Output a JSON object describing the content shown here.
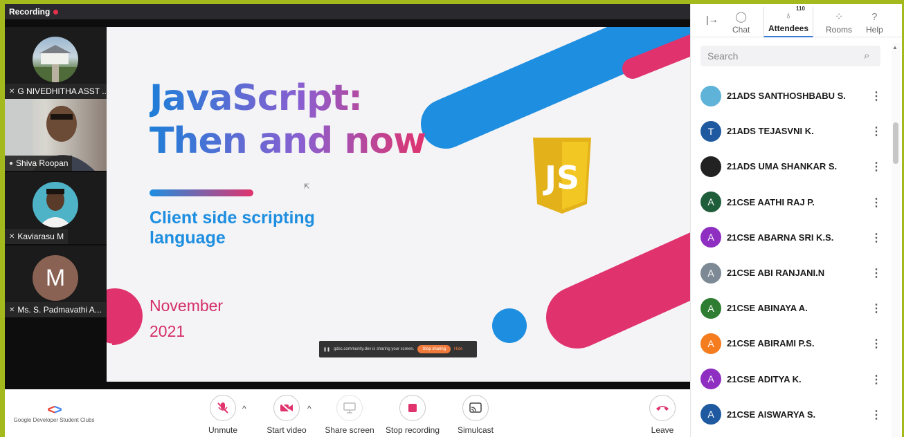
{
  "recording": {
    "label": "Recording"
  },
  "participants": [
    {
      "name": "G NIVEDHITHA ASST ..."
    },
    {
      "name": "Shiva Roopan"
    },
    {
      "name": "Kaviarasu M"
    },
    {
      "name": "Ms. S. Padmavathi A...",
      "initial": "M"
    }
  ],
  "slide": {
    "title_line1": "JavaScript:",
    "title_line2": "Then and now",
    "subtitle": "Client side scripting language",
    "date_month": "November",
    "date_year": "2021",
    "logo_text": "JS"
  },
  "share_notice": {
    "text": "gdsc.community.dev is sharing your screen.",
    "stop_label": "Stop sharing",
    "hide_label": "Hide"
  },
  "toolbar": {
    "brand": "Google Developer Student Clubs",
    "unmute": "Unmute",
    "start_video": "Start video",
    "share_screen": "Share screen",
    "stop_recording": "Stop recording",
    "simulcast": "Simulcast",
    "leave": "Leave"
  },
  "panel": {
    "tabs": {
      "chat": "Chat",
      "attendees": "Attendees",
      "rooms": "Rooms",
      "help": "Help"
    },
    "attendee_count": "110",
    "search_placeholder": "Search",
    "attendees": [
      {
        "name": "21ADS SANTHOSHBABU S.",
        "initial": "",
        "color": "#5fb3d9"
      },
      {
        "name": "21ADS TEJASVNI K.",
        "initial": "T",
        "color": "#1f5aa0"
      },
      {
        "name": "21ADS UMA SHANKAR S.",
        "initial": "",
        "color": "#222222"
      },
      {
        "name": "21CSE AATHI RAJ P.",
        "initial": "A",
        "color": "#1e5e3a"
      },
      {
        "name": "21CSE ABARNA SRI K.S.",
        "initial": "A",
        "color": "#8e2fc2"
      },
      {
        "name": "21CSE ABI RANJANI.N",
        "initial": "A",
        "color": "#7d8a95"
      },
      {
        "name": "21CSE ABINAYA A.",
        "initial": "A",
        "color": "#2e7d32"
      },
      {
        "name": "21CSE ABIRAMI P.S.",
        "initial": "A",
        "color": "#f57c1f"
      },
      {
        "name": "21CSE ADITYA K.",
        "initial": "A",
        "color": "#8e2fc2"
      },
      {
        "name": "21CSE AISWARYA S.",
        "initial": "A",
        "color": "#1f5aa0"
      }
    ]
  }
}
